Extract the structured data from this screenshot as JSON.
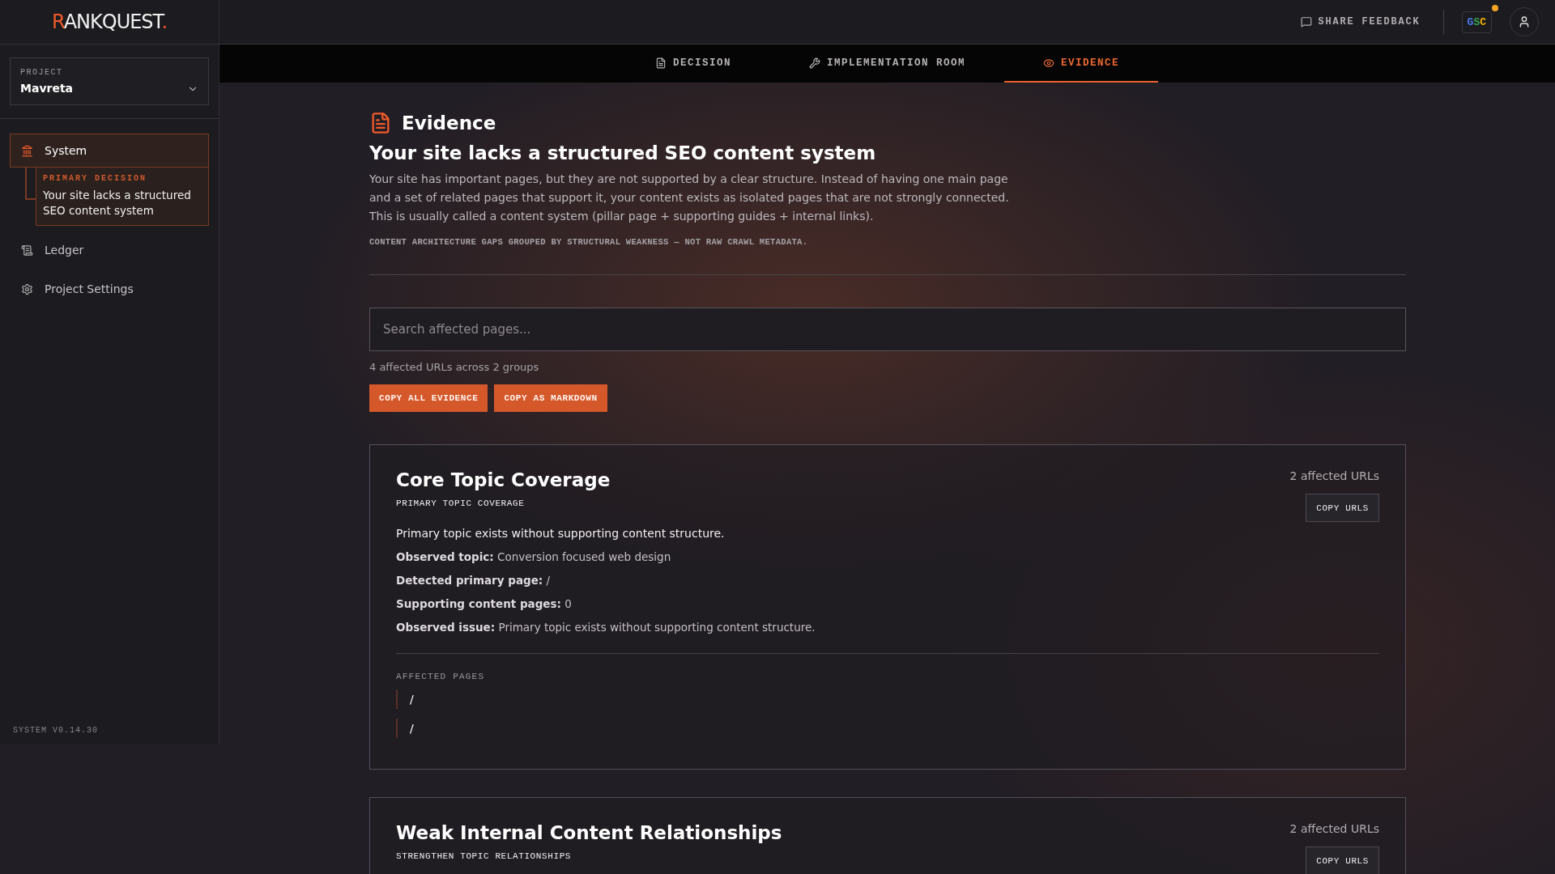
{
  "brand": {
    "first": "R",
    "rest": "ANKQUEST",
    "dot": "."
  },
  "topbar": {
    "feedback": "SHARE FEEDBACK",
    "gsc": "GSC",
    "gsc_alert": true
  },
  "tabs": [
    {
      "label": "DECISION",
      "selected": false
    },
    {
      "label": "IMPLEMENTATION ROOM",
      "selected": false
    },
    {
      "label": "EVIDENCE",
      "selected": true
    }
  ],
  "sidebar": {
    "project": {
      "label": "PROJECT",
      "value": "Mavreta"
    },
    "items": [
      {
        "label": "System",
        "selected": true,
        "child": {
          "tag": "PRIMARY DECISION",
          "text": "Your site lacks a structured SEO content system"
        }
      },
      {
        "label": "Ledger",
        "selected": false
      },
      {
        "label": "Project Settings",
        "selected": false
      }
    ],
    "version": "SYSTEM V0.14.30"
  },
  "header": {
    "title": "Evidence",
    "heading": "Your site lacks a structured SEO content system",
    "body": "Your site has important pages, but they are not supported by a clear structure. Instead of having one main page and a set of related pages that support it, your content exists as isolated pages that are not strongly connected. This is usually called a content system (pillar page + supporting guides + internal links).",
    "caption": "CONTENT ARCHITECTURE GAPS GROUPED BY STRUCTURAL WEAKNESS — NOT RAW CRAWL METADATA."
  },
  "search": {
    "placeholder": "Search affected pages..."
  },
  "summary": "4 affected URLs across 2 groups",
  "actions": [
    "COPY ALL EVIDENCE",
    "COPY AS MARKDOWN"
  ],
  "groups": [
    {
      "title": "Core Topic Coverage",
      "code": "PRIMARY TOPIC COVERAGE",
      "count": "2 affected URLs",
      "button": "COPY URLS",
      "summary": "Primary topic exists without supporting content structure.",
      "facts": [
        "**Observed topic:** Conversion focused web design",
        "**Detected primary page:** /",
        "**Supporting content pages:** 0",
        "**Observed issue:** Primary topic exists without supporting content structure."
      ],
      "pages_label": "AFFECTED PAGES",
      "pages": [
        "/",
        "/"
      ]
    },
    {
      "title": "Weak Internal Content Relationships",
      "code": "STRENGTHEN TOPIC RELATIONSHIPS",
      "count": "2 affected URLs",
      "button": "COPY URLS"
    }
  ]
}
